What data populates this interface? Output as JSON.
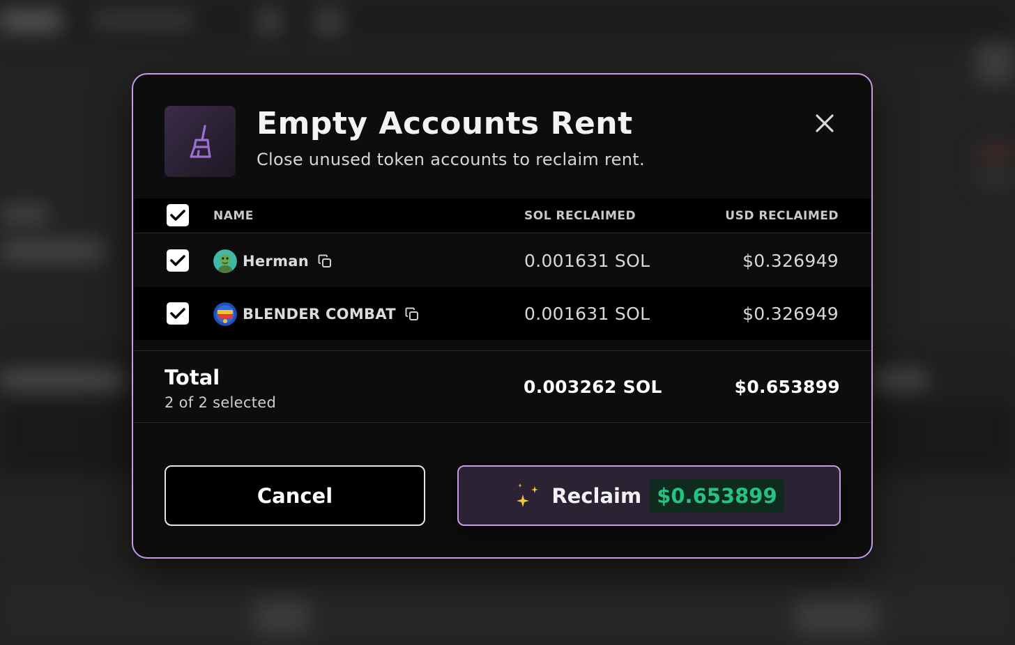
{
  "modal": {
    "title": "Empty Accounts Rent",
    "subtitle": "Close unused token accounts to reclaim rent.",
    "header_icon": "broom-icon",
    "close_icon": "close-icon"
  },
  "table": {
    "columns": {
      "name": "NAME",
      "sol": "SOL RECLAIMED",
      "usd": "USD RECLAIMED"
    },
    "select_all_checked": true,
    "rows": [
      {
        "name": "Herman",
        "sol": "0.001631 SOL",
        "usd": "$0.326949",
        "checked": true,
        "copy_icon": "copy-icon"
      },
      {
        "name": "BLENDER COMBAT",
        "sol": "0.001631 SOL",
        "usd": "$0.326949",
        "checked": true,
        "copy_icon": "copy-icon"
      }
    ]
  },
  "total": {
    "label": "Total",
    "selected": "2 of 2 selected",
    "sol": "0.003262 SOL",
    "usd": "$0.653899"
  },
  "actions": {
    "cancel_label": "Cancel",
    "reclaim_label": "Reclaim",
    "reclaim_amount": "$0.653899",
    "reclaim_icon": "sparkles-icon"
  },
  "colors": {
    "accent": "#c69be8",
    "positive": "#26c281"
  }
}
